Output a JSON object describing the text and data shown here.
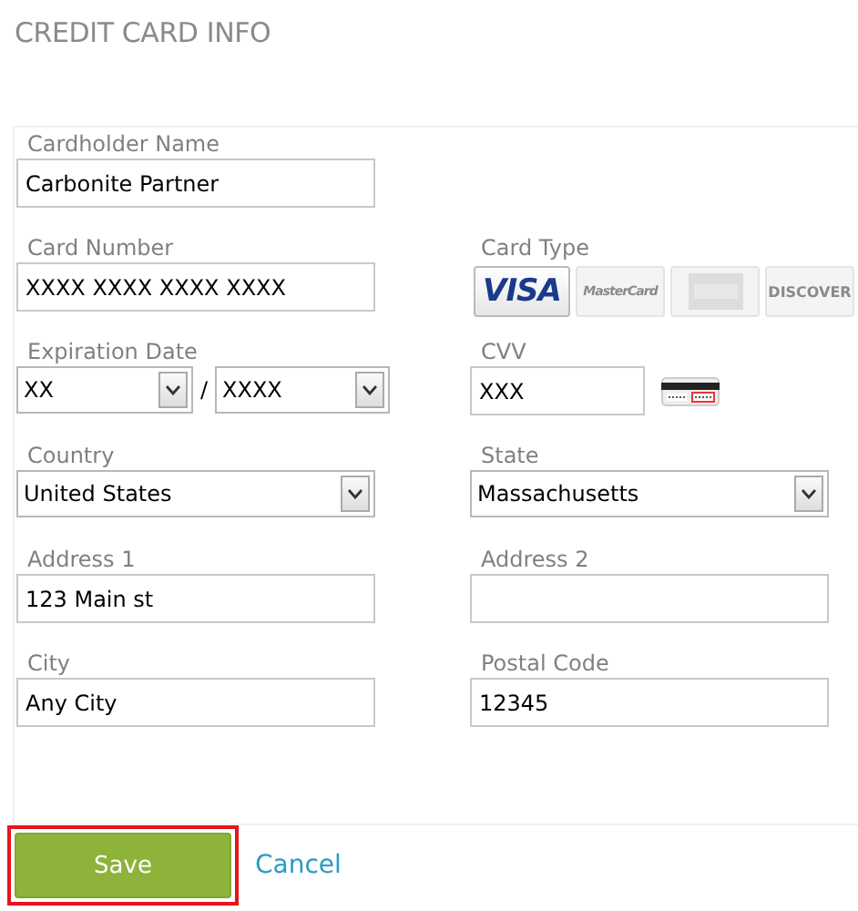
{
  "title": "CREDIT CARD INFO",
  "rows": [
    {
      "left": {
        "kind": "text",
        "label": "Cardholder Name",
        "value": "Carbonite Partner"
      }
    },
    {
      "left": {
        "kind": "text",
        "label": "Card Number",
        "value": "XXXX XXXX XXXX XXXX"
      },
      "right": {
        "kind": "card_types",
        "label": "Card Type",
        "cards": [
          {
            "label": "VISA",
            "selected": true
          },
          {
            "label": "MasterCard",
            "selected": false
          },
          {
            "selected": false
          },
          {
            "label": "DISCOVER",
            "selected": false
          }
        ]
      }
    },
    {
      "left": {
        "kind": "expiry",
        "label": "Expiration Date",
        "month": "XX",
        "separator": "/",
        "year": "XXXX"
      },
      "right": {
        "kind": "cvv",
        "label": "CVV",
        "value": "XXX"
      }
    },
    {
      "left": {
        "kind": "select",
        "label": "Country",
        "value": "United States"
      },
      "right": {
        "kind": "select",
        "label": "State",
        "value": "Massachusetts"
      }
    },
    {
      "left": {
        "kind": "text",
        "label": "Address 1",
        "value": "123 Main st"
      },
      "right": {
        "kind": "text",
        "label": "Address 2"
      }
    },
    {
      "left": {
        "kind": "text",
        "label": "City",
        "value": "Any City"
      },
      "right": {
        "kind": "text",
        "label": "Postal Code",
        "value": "12345"
      }
    }
  ],
  "save_button": {
    "label": "Save",
    "highlighted": true
  },
  "cancel_link": "Cancel"
}
